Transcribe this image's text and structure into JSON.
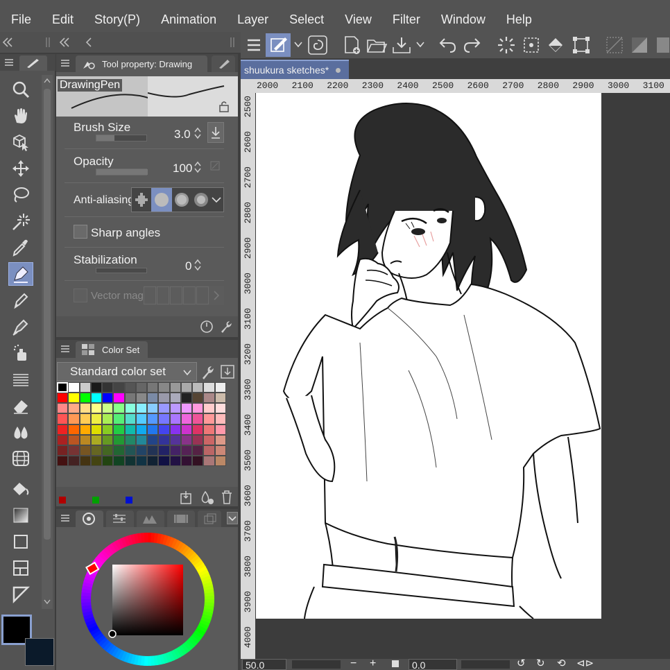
{
  "menu": [
    "File",
    "Edit",
    "Story(P)",
    "Animation",
    "Layer",
    "Select",
    "View",
    "Filter",
    "Window",
    "Help"
  ],
  "document_tab": "shuukura sketches*",
  "tool_property": {
    "panel_title": "Tool property: Drawing",
    "brush_name": "DrawingPen",
    "brush_size_label": "Brush Size",
    "brush_size_value": "3.0",
    "opacity_label": "Opacity",
    "opacity_value": "100",
    "anti_aliasing_label": "Anti-aliasing",
    "sharp_angles_label": "Sharp angles",
    "stabilization_label": "Stabilization",
    "stabilization_value": "0",
    "vector_magnet_label": "Vector mag"
  },
  "color_set": {
    "panel_title": "Color Set",
    "set_name": "Standard color set",
    "recent_colors": [
      "#b00000",
      "#00a000",
      "#0010d0"
    ]
  },
  "ruler_h": [
    "2000",
    "2100",
    "2200",
    "2300",
    "2400",
    "2500",
    "2600",
    "2700",
    "2800",
    "2900",
    "3000",
    "3100"
  ],
  "ruler_v": [
    "2500",
    "2600",
    "2700",
    "2800",
    "2900",
    "3000",
    "3100",
    "3200",
    "3300",
    "3400",
    "3500",
    "3600",
    "3700",
    "3800",
    "3900",
    "4000"
  ],
  "status": {
    "zoom": "50.0",
    "angle": "0.0"
  },
  "colors": {
    "main_color": "#000000",
    "sub_color": "#0b1a2a",
    "accent": "#7b8fc0"
  }
}
